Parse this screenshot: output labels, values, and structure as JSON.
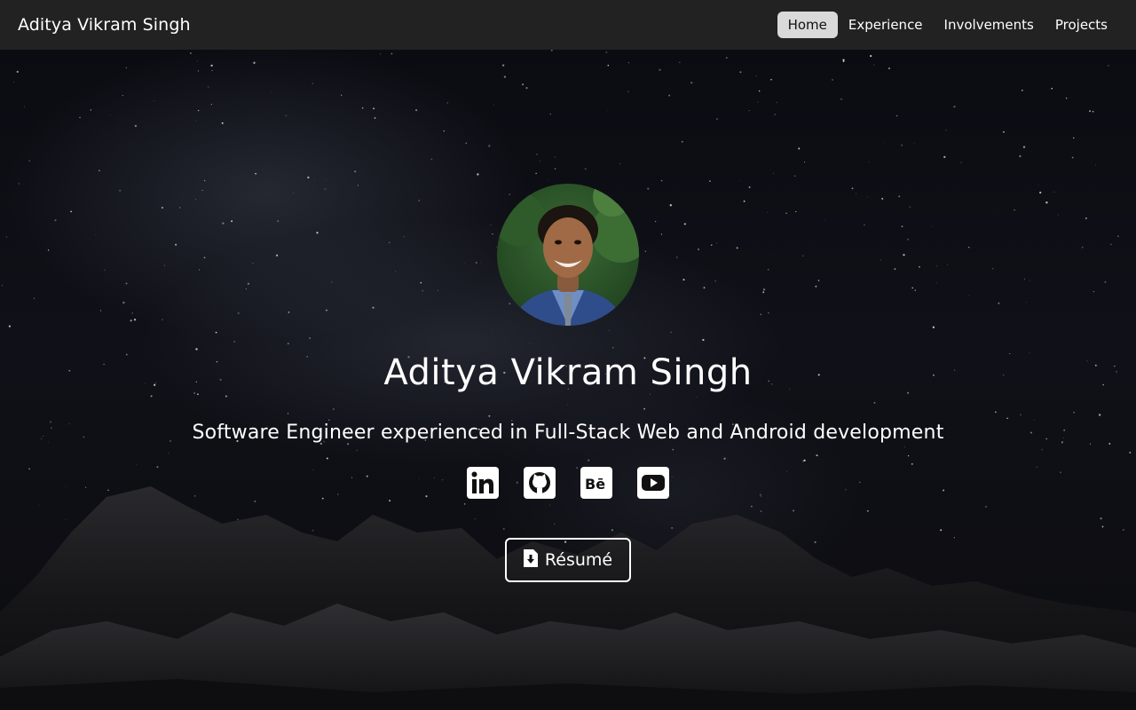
{
  "nav": {
    "brand": "Aditya Vikram Singh",
    "links": [
      {
        "label": "Home",
        "active": true
      },
      {
        "label": "Experience",
        "active": false
      },
      {
        "label": "Involvements",
        "active": false
      },
      {
        "label": "Projects",
        "active": false
      }
    ]
  },
  "hero": {
    "name": "Aditya Vikram Singh",
    "tagline": "Software Engineer experienced in Full-Stack Web and Android development",
    "avatar_icon": "profile-photo",
    "socials": [
      {
        "icon": "linkedin-icon"
      },
      {
        "icon": "github-icon"
      },
      {
        "icon": "behance-icon"
      },
      {
        "icon": "youtube-icon"
      }
    ],
    "resume_label": "Résumé",
    "resume_icon": "file-download-icon"
  },
  "colors": {
    "navbar": "#222222",
    "active_nav_bg": "#d9d9d9",
    "background": "#08080c",
    "text": "#ffffff"
  }
}
